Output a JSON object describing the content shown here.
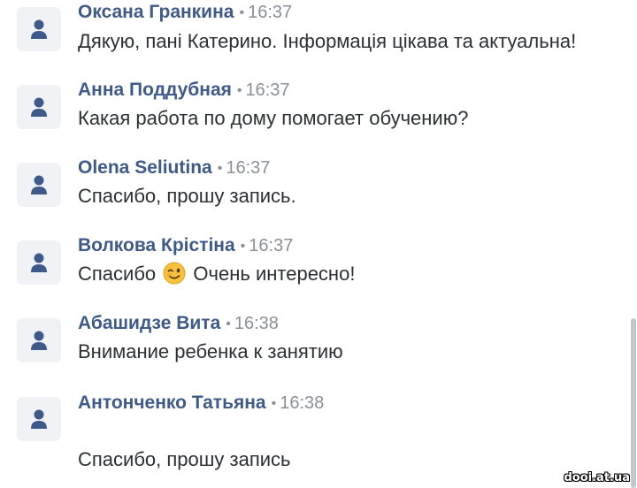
{
  "messages": [
    {
      "author": "Оксана Гранкина",
      "time": "16:37",
      "text": "Дякую, пані Катерино. Інформація цікава та актуальна!"
    },
    {
      "author": "Анна Поддубная",
      "time": "16:37",
      "text": "Какая работа по дому помогает обучению?"
    },
    {
      "author": "Olena Seliutina",
      "time": "16:37",
      "text": "Спасибо, прошу запись."
    },
    {
      "author": "Волкова Крістіна",
      "time": "16:37",
      "text_before_emoji": "Спасибо",
      "emoji": "winking-face",
      "text_after_emoji": "Очень интересно!"
    },
    {
      "author": "Абашидзе Вита",
      "time": "16:38",
      "text": "Внимание ребенка к занятию"
    },
    {
      "author": "Антонченко Татьяна",
      "time": "16:38",
      "text": "Спасибо, прошу запись"
    }
  ],
  "separator": "•",
  "watermark": "dooi.at.ua",
  "colors": {
    "author": "#3d5a8a",
    "time": "#8a8f98",
    "text": "#2c2f33",
    "avatar_bg": "#f0f2f6",
    "avatar_icon": "#3d5a8a",
    "scrollbar": "#c3c6cb"
  }
}
